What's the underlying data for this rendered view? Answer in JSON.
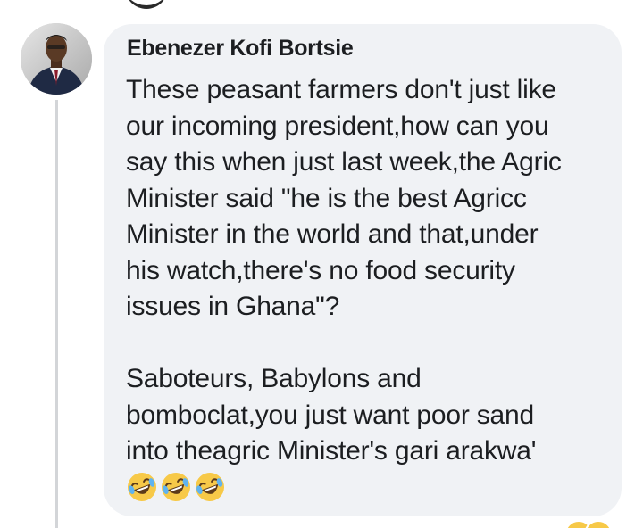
{
  "comment": {
    "author": "Ebenezer Kofi Bortsie",
    "lines": [
      "These peasant farmers don't just like",
      "our incoming president,how can you",
      "say this when just last week,the Agric",
      "Minister said \"he is the best Agricc",
      "Minister in the world and that,under",
      "his watch,there's no food security",
      "issues in Ghana\"?",
      "",
      "Saboteurs, Babylons and",
      "bomboclat,you just want poor sand",
      "into theagric Minister's gari arakwa'"
    ],
    "emojis": [
      "rolling-on-floor-laughing",
      "rolling-on-floor-laughing",
      "rolling-on-floor-laughing"
    ]
  },
  "colors": {
    "bubble": "#f0f2f5",
    "text": "#1c1e21",
    "thread_line": "#d3d5d8",
    "emoji_face": "#f7c948"
  }
}
